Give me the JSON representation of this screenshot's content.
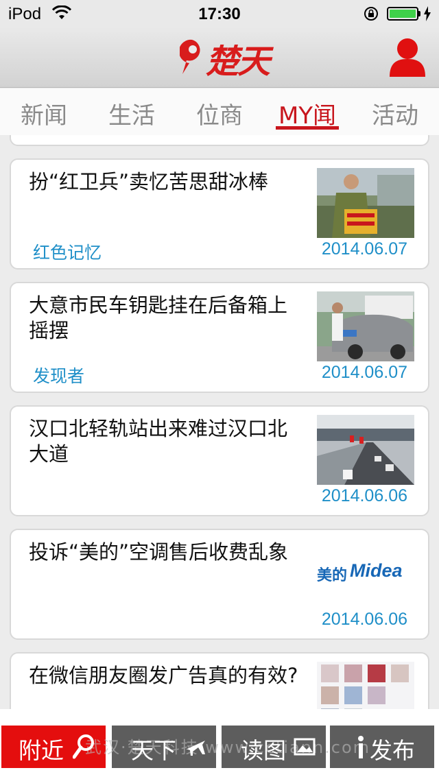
{
  "status_bar": {
    "carrier": "iPod",
    "time": "17:30"
  },
  "header": {
    "logo_text": "楚天",
    "icons": [
      "pin-logo-icon",
      "profile-icon"
    ],
    "brand_color": "#d81c1c"
  },
  "tabs": [
    {
      "label": "新闻",
      "active": false
    },
    {
      "label": "生活",
      "active": false
    },
    {
      "label": "位商",
      "active": false
    },
    {
      "label": "MY闻",
      "active": true
    },
    {
      "label": "活动",
      "active": false
    }
  ],
  "articles": [
    {
      "title": "扮“红卫兵”卖忆苦思甜冰棒",
      "tag": "红色记忆",
      "date": "2014.06.07",
      "thumb": "person-photo"
    },
    {
      "title": "大意市民车钥匙挂在后备箱上摇摆",
      "tag": "发现者",
      "date": "2014.06.07",
      "thumb": "car-photo"
    },
    {
      "title": "汉口北轻轨站出来难过汉口北大道",
      "tag": "",
      "date": "2014.06.06",
      "thumb": "road-photo"
    },
    {
      "title": "投诉“美的”空调售后收费乱象",
      "tag": "",
      "date": "2014.06.06",
      "thumb": "midea-logo",
      "thumb_text": "美的",
      "thumb_brand": "Midea"
    },
    {
      "title": "在微信朋友圈发广告真的有效?",
      "tag": "",
      "date": "",
      "thumb": "wechat-photo"
    }
  ],
  "toolbar": {
    "nearby": "附近",
    "world": "天下",
    "read": "读图",
    "publish": "发布",
    "active_color": "#e40e0e",
    "inactive_color": "#5d5d5d"
  },
  "watermark": "武汉·楚天科技  www.cctiann.com"
}
